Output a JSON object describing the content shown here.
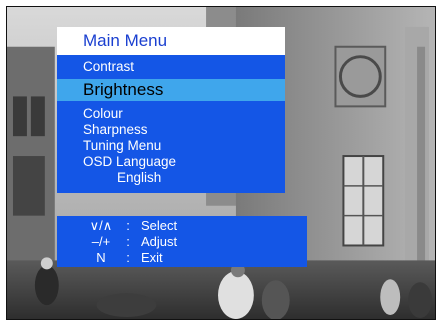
{
  "menu": {
    "title": "Main Menu",
    "items": [
      {
        "label": "Contrast"
      },
      {
        "label": "Brightness",
        "selected": true
      },
      {
        "label": "Colour"
      },
      {
        "label": "Sharpness"
      },
      {
        "label": "Tuning Menu"
      },
      {
        "label": "OSD Language"
      },
      {
        "label": "English"
      }
    ]
  },
  "help": {
    "rows": [
      {
        "keys": "∨/∧",
        "sep": ":",
        "action": "Select"
      },
      {
        "keys": "–/+",
        "sep": ":",
        "action": "Adjust"
      },
      {
        "keys": "N",
        "sep": ":",
        "action": "Exit"
      }
    ]
  },
  "colors": {
    "panel_blue": "#1456e6",
    "highlight_blue": "#3fa6ec",
    "title_text": "#1a3fd0",
    "menu_text": "#ffffff",
    "selected_text": "#000000"
  }
}
